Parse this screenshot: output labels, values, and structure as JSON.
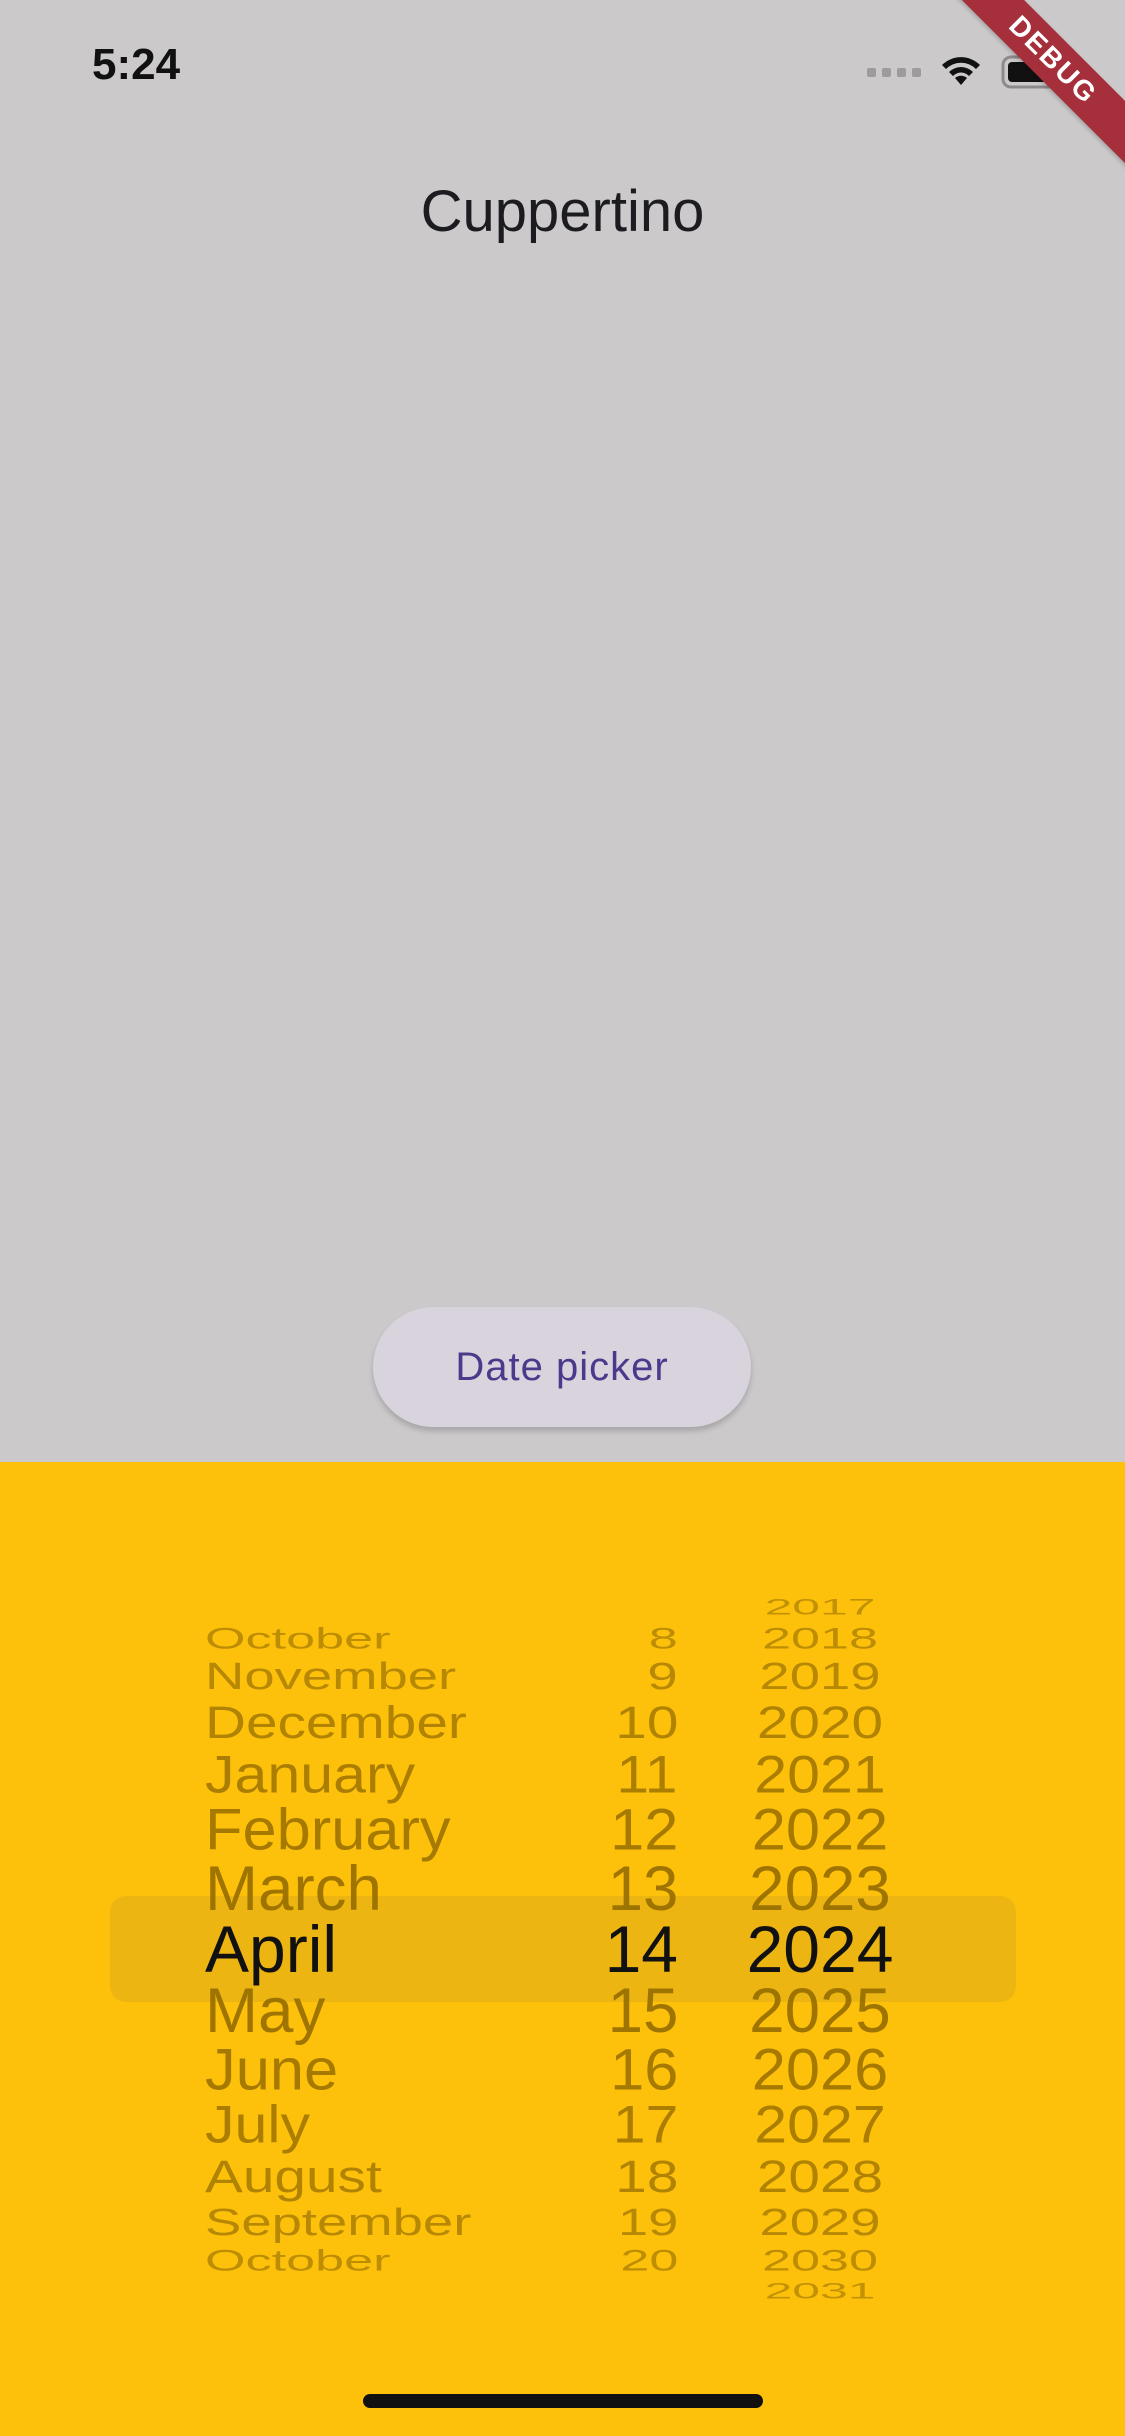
{
  "status_bar": {
    "time": "5:24",
    "debug_label": "DEBUG"
  },
  "nav": {
    "title": "Cuppertino"
  },
  "actions": {
    "date_picker_label": "Date picker"
  },
  "picker": {
    "background_color": "#fec10b",
    "months": [
      "October",
      "November",
      "December",
      "January",
      "February",
      "March",
      "April",
      "May",
      "June",
      "July",
      "August",
      "September",
      "October"
    ],
    "days": [
      "8",
      "9",
      "10",
      "11",
      "12",
      "13",
      "14",
      "15",
      "16",
      "17",
      "18",
      "19",
      "20"
    ],
    "years": [
      "2017",
      "2018",
      "2019",
      "2020",
      "2021",
      "2022",
      "2023",
      "2024",
      "2025",
      "2026",
      "2027",
      "2028",
      "2029",
      "2030",
      "2031"
    ],
    "selected": {
      "month": "April",
      "day": "14",
      "year": "2024"
    }
  }
}
